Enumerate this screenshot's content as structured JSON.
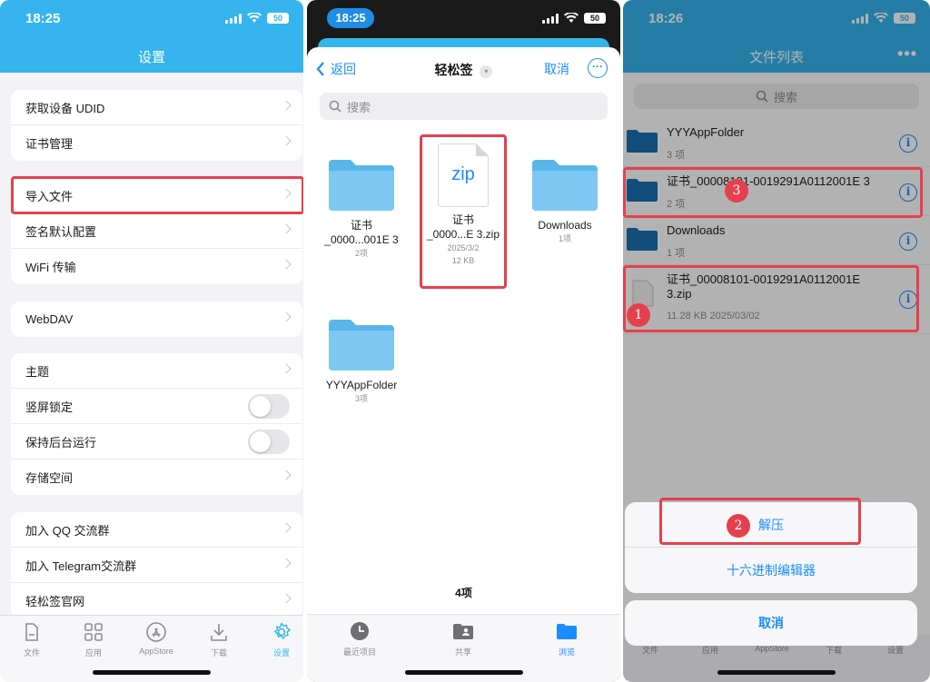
{
  "colors": {
    "accent": "#35b4ee",
    "link": "#1a8cff",
    "highlight": "#e5404e"
  },
  "panel1": {
    "status": {
      "time": "18:25",
      "battery": "50"
    },
    "title": "设置",
    "groups": [
      {
        "rows": [
          {
            "label": "获取设备 UDID"
          },
          {
            "label": "证书管理"
          }
        ]
      },
      {
        "rows": [
          {
            "label": "导入文件"
          },
          {
            "label": "签名默认配置"
          },
          {
            "label": "WiFi 传输"
          }
        ]
      },
      {
        "rows": [
          {
            "label": "WebDAV"
          }
        ]
      },
      {
        "rows": [
          {
            "label": "主题"
          },
          {
            "label": "竖屏锁定",
            "toggle": "off"
          },
          {
            "label": "保持后台运行",
            "toggle": "off"
          },
          {
            "label": "存储空间"
          }
        ]
      },
      {
        "rows": [
          {
            "label": "加入 QQ 交流群"
          },
          {
            "label": "加入 Telegram交流群"
          },
          {
            "label": "轻松签官网"
          }
        ]
      }
    ],
    "tabs": [
      {
        "label": "文件",
        "icon": "file-icon"
      },
      {
        "label": "应用",
        "icon": "apps-grid-icon"
      },
      {
        "label": "AppStore",
        "icon": "appstore-icon"
      },
      {
        "label": "下载",
        "icon": "download-icon"
      },
      {
        "label": "设置",
        "icon": "gear-icon",
        "active": true
      }
    ]
  },
  "panel2": {
    "status": {
      "time": "18:25",
      "battery": "50"
    },
    "back_label": "返回",
    "title": "轻松签",
    "cancel_label": "取消",
    "search_placeholder": "搜索",
    "items": [
      {
        "name": "证书",
        "name2": "_0000...001E 3",
        "meta": "2项",
        "kind": "folder"
      },
      {
        "name": "证书",
        "name2": "_0000...E 3.zip",
        "meta": "2025/3/2",
        "meta2": "12 KB",
        "kind": "zip",
        "zip_label": "zip"
      },
      {
        "name": "Downloads",
        "meta": "1项",
        "kind": "folder"
      },
      {
        "name": "YYYAppFolder",
        "meta": "3项",
        "kind": "folder"
      }
    ],
    "count": "4项",
    "tabs": [
      {
        "label": "最近项目",
        "icon": "clock-icon"
      },
      {
        "label": "共享",
        "icon": "shared-folder-icon"
      },
      {
        "label": "浏览",
        "icon": "folder-icon",
        "active": true
      }
    ]
  },
  "panel3": {
    "status": {
      "time": "18:26",
      "battery": "50"
    },
    "title": "文件列表",
    "search_placeholder": "搜索",
    "rows": [
      {
        "name": "YYYAppFolder",
        "meta": "3 项",
        "kind": "folder"
      },
      {
        "name": "证书_00008101-0019291A0112001E 3",
        "meta": "2 项",
        "kind": "folder"
      },
      {
        "name": "Downloads",
        "meta": "1 项",
        "kind": "folder"
      },
      {
        "name": "证书_00008101-0019291A0112001E 3.zip",
        "meta": "11.28 KB   2025/03/02",
        "kind": "file"
      }
    ],
    "markers": [
      "1",
      "2",
      "3"
    ],
    "actions": [
      "解压",
      "十六进制编辑器"
    ],
    "cancel_label": "取消",
    "tabs": [
      "文件",
      "应用",
      "AppStore",
      "下载",
      "设置"
    ]
  }
}
